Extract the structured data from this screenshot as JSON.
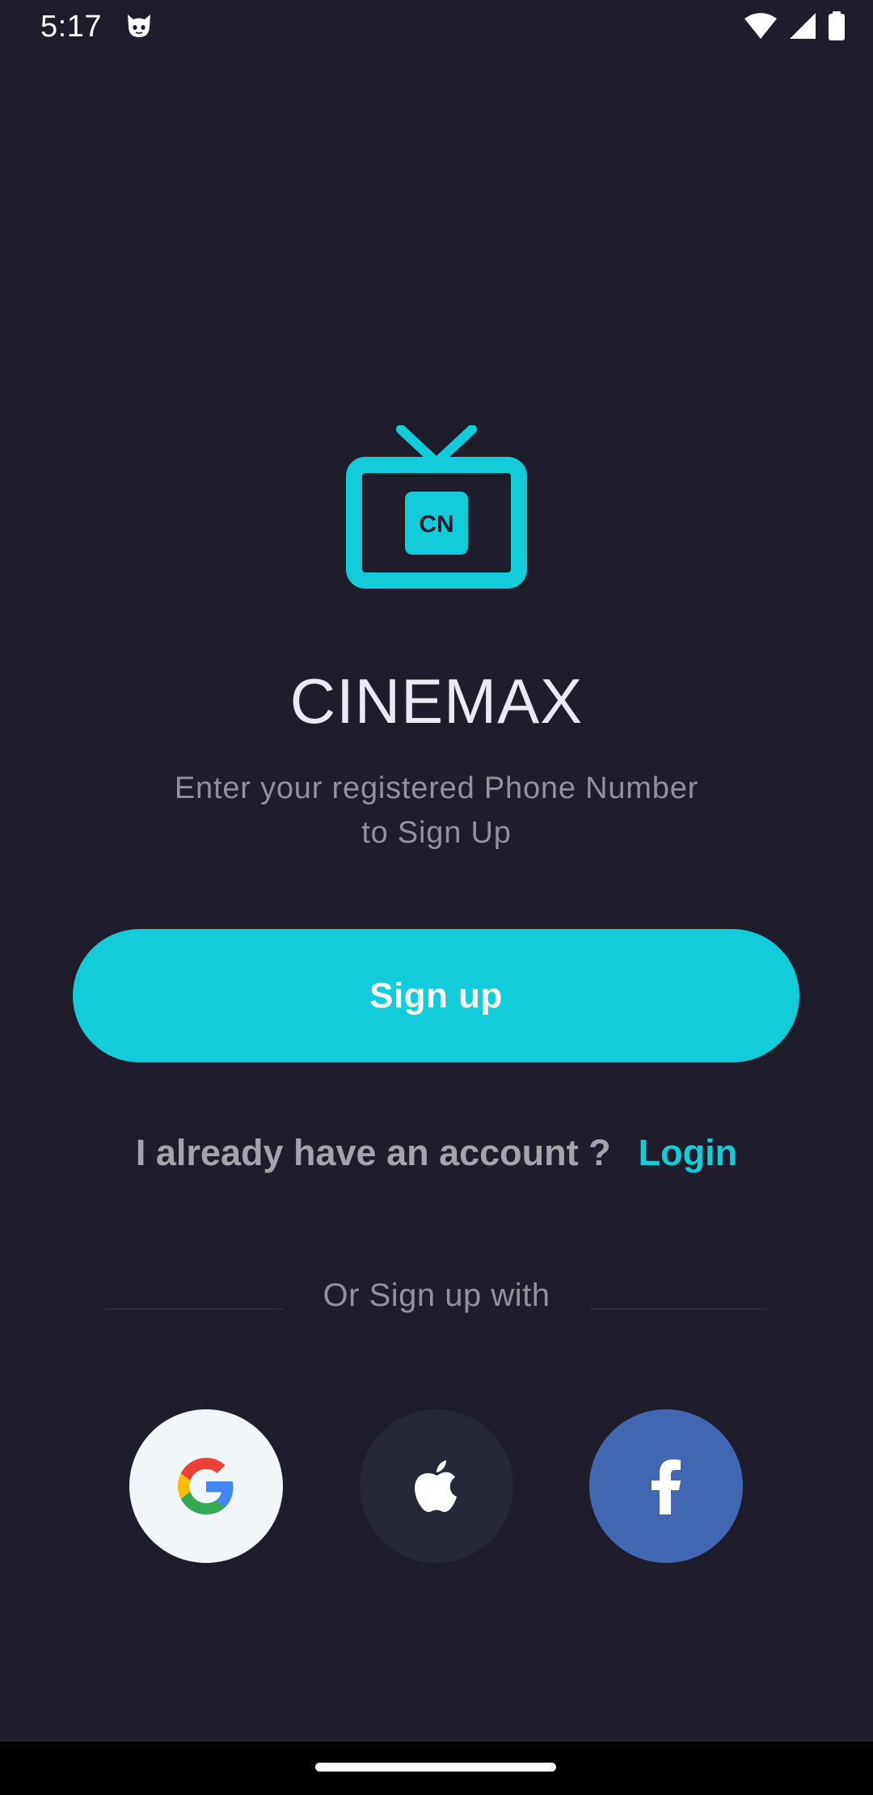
{
  "status_bar": {
    "time": "5:17",
    "icons": [
      "cat-icon",
      "wifi-icon",
      "signal-icon",
      "battery-icon"
    ]
  },
  "logo": {
    "badge_text": "CN",
    "icon": "tv-icon",
    "color": "#12cdd9"
  },
  "title": "CINEMAX",
  "subtitle": "Enter your registered Phone Number to Sign Up",
  "signup_button": {
    "label": "Sign up",
    "color": "#12cdd9"
  },
  "account_prompt": {
    "text": "I already have an account ?",
    "login_label": "Login"
  },
  "divider": {
    "text": "Or Sign up with"
  },
  "social": [
    {
      "name": "google",
      "icon": "google-icon",
      "background": "#f1f6f9"
    },
    {
      "name": "apple",
      "icon": "apple-icon",
      "background": "#252836"
    },
    {
      "name": "facebook",
      "icon": "facebook-icon",
      "background": "#4267b2"
    }
  ],
  "colors": {
    "background": "#1f1d2b",
    "accent": "#12cdd9",
    "muted_text": "#92929d"
  }
}
